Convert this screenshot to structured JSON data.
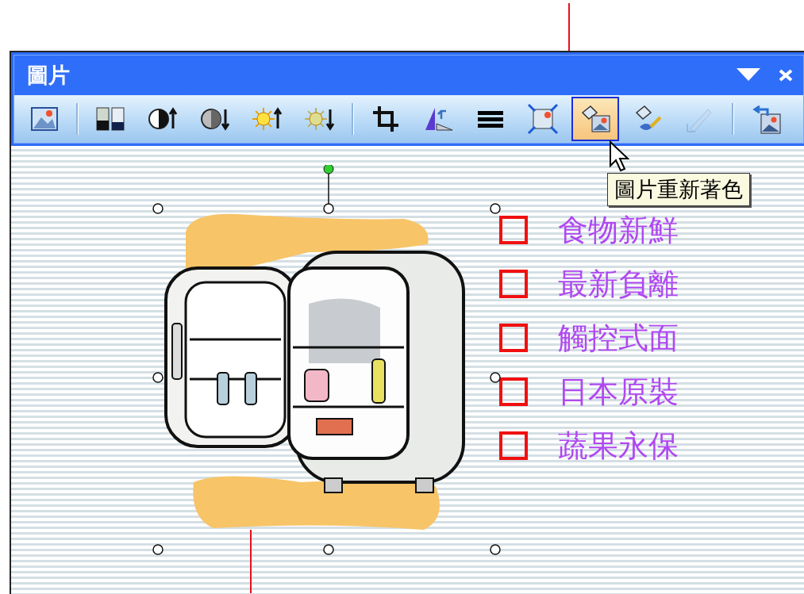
{
  "window": {
    "title": "圖片"
  },
  "toolbar": {
    "groups": [
      [
        {
          "kind": "insert-picture",
          "selected": false,
          "disabled": false
        }
      ],
      [
        {
          "kind": "color",
          "selected": false,
          "disabled": false
        },
        {
          "kind": "contrast-up",
          "selected": false,
          "disabled": false
        },
        {
          "kind": "contrast-down",
          "selected": false,
          "disabled": false
        },
        {
          "kind": "brightness-up",
          "selected": false,
          "disabled": false
        },
        {
          "kind": "brightness-down",
          "selected": false,
          "disabled": false
        }
      ],
      [
        {
          "kind": "crop",
          "selected": false,
          "disabled": false
        },
        {
          "kind": "rotate",
          "selected": false,
          "disabled": false
        },
        {
          "kind": "line-style",
          "selected": false,
          "disabled": false
        },
        {
          "kind": "compress",
          "selected": false,
          "disabled": false
        },
        {
          "kind": "recolor",
          "selected": true,
          "disabled": false
        },
        {
          "kind": "format",
          "selected": false,
          "disabled": false
        },
        {
          "kind": "transparent",
          "selected": false,
          "disabled": true
        }
      ],
      [
        {
          "kind": "reset",
          "selected": false,
          "disabled": false
        }
      ]
    ]
  },
  "tooltip": "圖片重新著色",
  "slide": {
    "items": [
      {
        "text": "食物新鮮",
        "checked": false
      },
      {
        "text": "最新負離",
        "checked": false
      },
      {
        "text": "觸控式面",
        "checked": false
      },
      {
        "text": "日本原裝",
        "checked": false
      },
      {
        "text": "蔬果永保",
        "checked": false
      }
    ]
  }
}
